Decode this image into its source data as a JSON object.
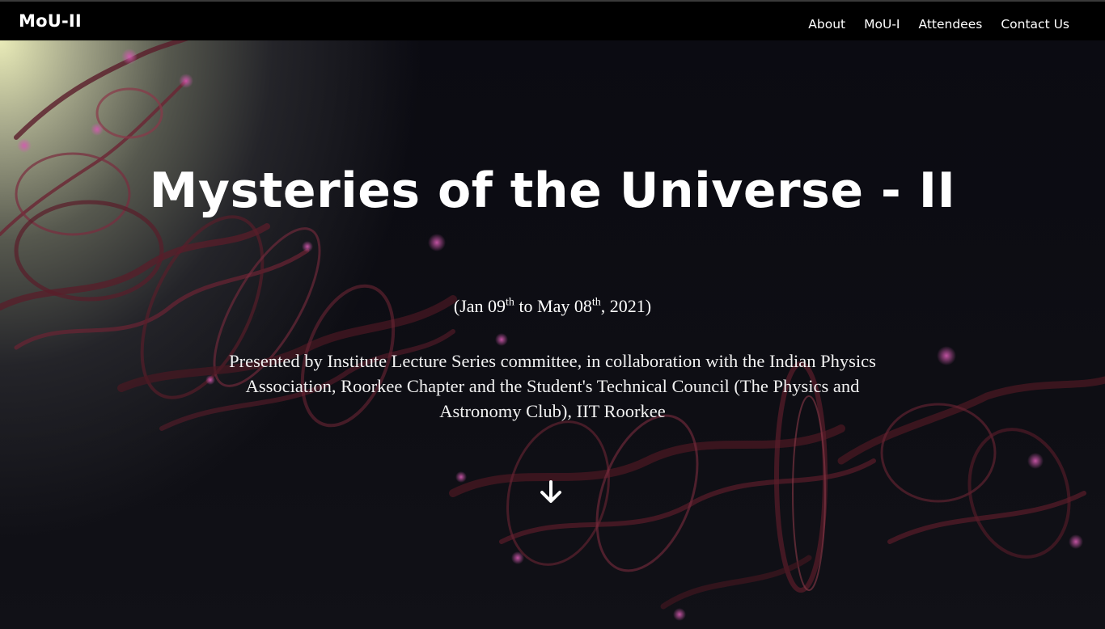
{
  "navbar": {
    "brand": "MoU-II",
    "links": [
      {
        "label": "About"
      },
      {
        "label": "MoU-I"
      },
      {
        "label": "Attendees"
      },
      {
        "label": "Contact Us"
      }
    ]
  },
  "hero": {
    "title": "Mysteries of the Universe - II",
    "dates": {
      "open_paren": "(",
      "start_text": "Jan 09",
      "start_sup": "th",
      "connector": " to May 08",
      "end_sup": "th",
      "year_text": ", 2021)"
    },
    "presented_by": "Presented by Institute Lecture Series committee, in collaboration with the Indian Physics Association, Roorkee Chapter and the Student's Technical Council (The Physics and Astronomy Club), IIT Roorkee",
    "scroll_icon": "arrow-down-icon"
  },
  "colors": {
    "navbar_bg": "#000000",
    "text": "#ffffff",
    "glow": "#e9ebb8",
    "fractal_dark": "#5a1d2a",
    "fractal_mid": "#8a3848",
    "fractal_pink": "#c24aa0"
  }
}
